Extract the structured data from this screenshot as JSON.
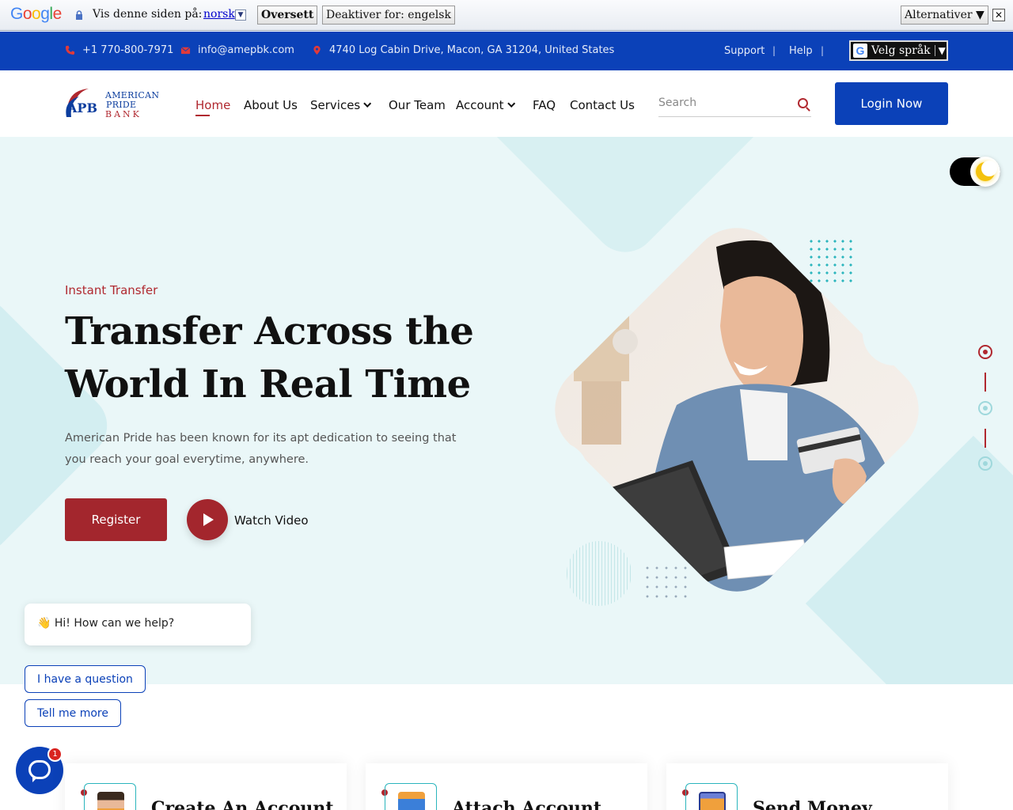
{
  "translate_bar": {
    "logo": "Google",
    "prompt": "Vis denne siden på:",
    "language": "norsk",
    "translate_button": "Oversett",
    "disable_button": "Deaktiver for: engelsk",
    "options_button": "Alternativer ▼",
    "close": "✕"
  },
  "topbar": {
    "phone": "+1 770-800-7971",
    "email": "info@amepbk.com",
    "address": "4740 Log Cabin Drive, Macon, GA 31204, United States",
    "support": "Support",
    "help": "Help",
    "language_select": "Velg språk",
    "language_arrow": "▼"
  },
  "logo": {
    "abbr": "APB",
    "line1": "AMERICAN",
    "line2": "PRIDE",
    "line3": "BANK"
  },
  "nav": {
    "home": "Home",
    "about": "About Us",
    "services": "Services",
    "team": "Our Team",
    "account": "Account",
    "faq": "FAQ",
    "contact": "Contact Us",
    "search_placeholder": "Search",
    "login": "Login Now"
  },
  "hero": {
    "subtitle": "Instant Transfer",
    "headline": "Transfer Across the World In Real Time",
    "description": "American Pride has been known for its apt dedication to seeing that you reach your goal everytime, anywhere.",
    "register": "Register",
    "watch_video": "Watch Video"
  },
  "chat": {
    "greeting": "👋 Hi! How can we help?",
    "option1": "I have a question",
    "option2": "Tell me more",
    "badge": "1"
  },
  "features": [
    {
      "title": "Create An Account",
      "icon": "user-icon",
      "color": "#f0a03c"
    },
    {
      "title": "Attach Account",
      "icon": "bank-icon",
      "color": "#3b7fd9"
    },
    {
      "title": "Send Money",
      "icon": "money-icon",
      "color": "#f0a03c"
    }
  ],
  "colors": {
    "primary_blue": "#0b41b8",
    "accent_red": "#b0282f",
    "hero_bg": "#eaf7f8",
    "teal": "#2bb5bd"
  }
}
